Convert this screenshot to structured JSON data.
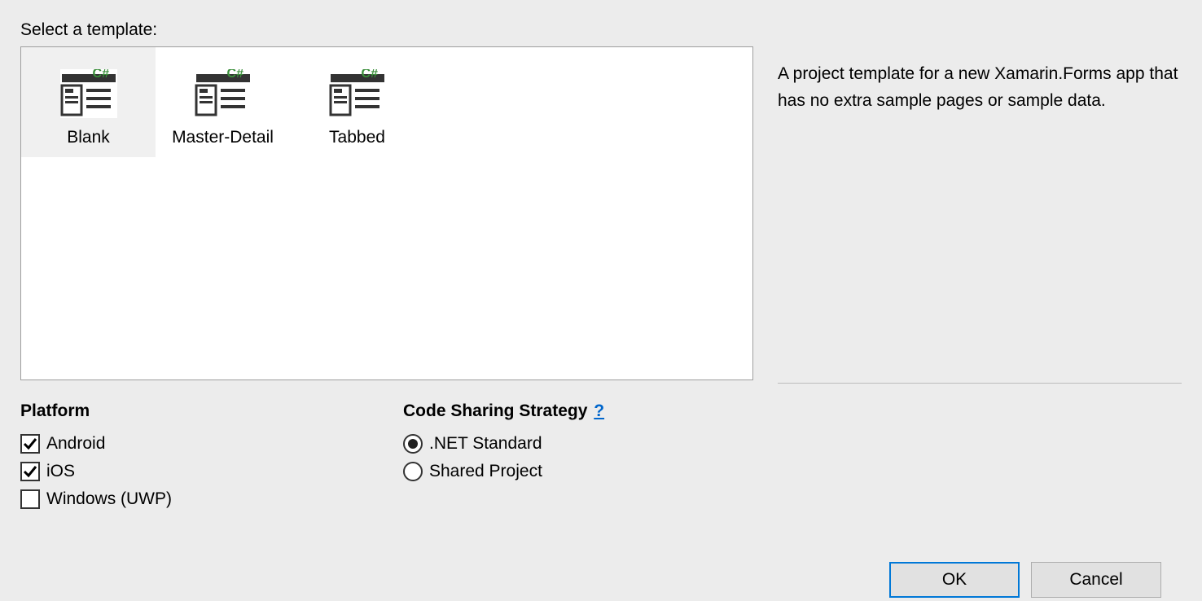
{
  "header": {
    "select_template_label": "Select a template:"
  },
  "templates": [
    {
      "label": "Blank",
      "selected": true
    },
    {
      "label": "Master-Detail",
      "selected": false
    },
    {
      "label": "Tabbed",
      "selected": false
    }
  ],
  "description": "A project template for a new Xamarin.Forms app that has no extra sample pages or sample data.",
  "platform": {
    "heading": "Platform",
    "options": [
      {
        "label": "Android",
        "checked": true
      },
      {
        "label": "iOS",
        "checked": true
      },
      {
        "label": "Windows (UWP)",
        "checked": false
      }
    ]
  },
  "strategy": {
    "heading": "Code Sharing Strategy",
    "help": "?",
    "options": [
      {
        "label": ".NET Standard",
        "selected": true
      },
      {
        "label": "Shared Project",
        "selected": false
      }
    ]
  },
  "buttons": {
    "ok": "OK",
    "cancel": "Cancel"
  }
}
